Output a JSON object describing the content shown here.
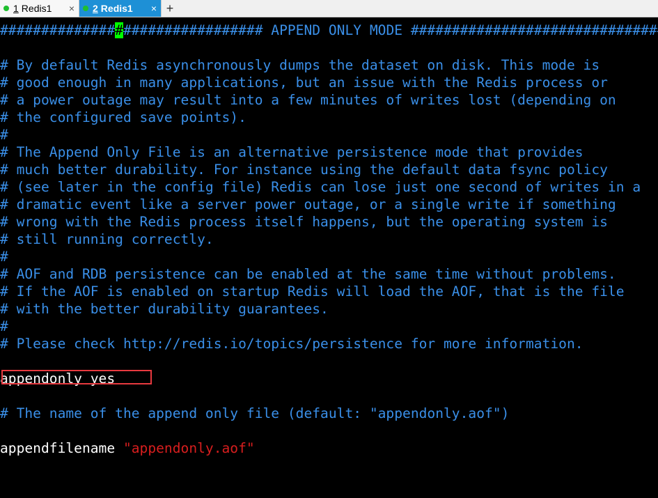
{
  "tabs": [
    {
      "number": "1",
      "label": "Redis1",
      "close": "×"
    },
    {
      "number": "2",
      "label": "Redis1",
      "close": "×"
    }
  ],
  "add_tab": "+",
  "terminal": {
    "header_prefix": "##############",
    "header_cursor": "#",
    "header_suffix": "################# APPEND ONLY MODE ###############################",
    "lines": [
      "",
      "# By default Redis asynchronously dumps the dataset on disk. This mode is",
      "# good enough in many applications, but an issue with the Redis process or",
      "# a power outage may result into a few minutes of writes lost (depending on",
      "# the configured save points).",
      "#",
      "# The Append Only File is an alternative persistence mode that provides",
      "# much better durability. For instance using the default data fsync policy",
      "# (see later in the config file) Redis can lose just one second of writes in a",
      "# dramatic event like a server power outage, or a single write if something",
      "# wrong with the Redis process itself happens, but the operating system is",
      "# still running correctly.",
      "#",
      "# AOF and RDB persistence can be enabled at the same time without problems.",
      "# If the AOF is enabled on startup Redis will load the AOF, that is the file",
      "# with the better durability guarantees.",
      "#",
      "# Please check http://redis.io/topics/persistence for more information."
    ],
    "appendonly_line": "appendonly yes",
    "filename_comment": "# The name of the append only file (default: \"appendonly.aof\")",
    "appendfilename_key": "appendfilename ",
    "appendfilename_value": "\"appendonly.aof\""
  },
  "colors": {
    "comment": "#3a8fe8",
    "text": "#ffffff",
    "string": "#d81e1e",
    "cursor": "#00ff00",
    "highlight_box": "#e8393f",
    "active_tab": "#1e90d6",
    "status_dot": "#1fbf2f"
  }
}
